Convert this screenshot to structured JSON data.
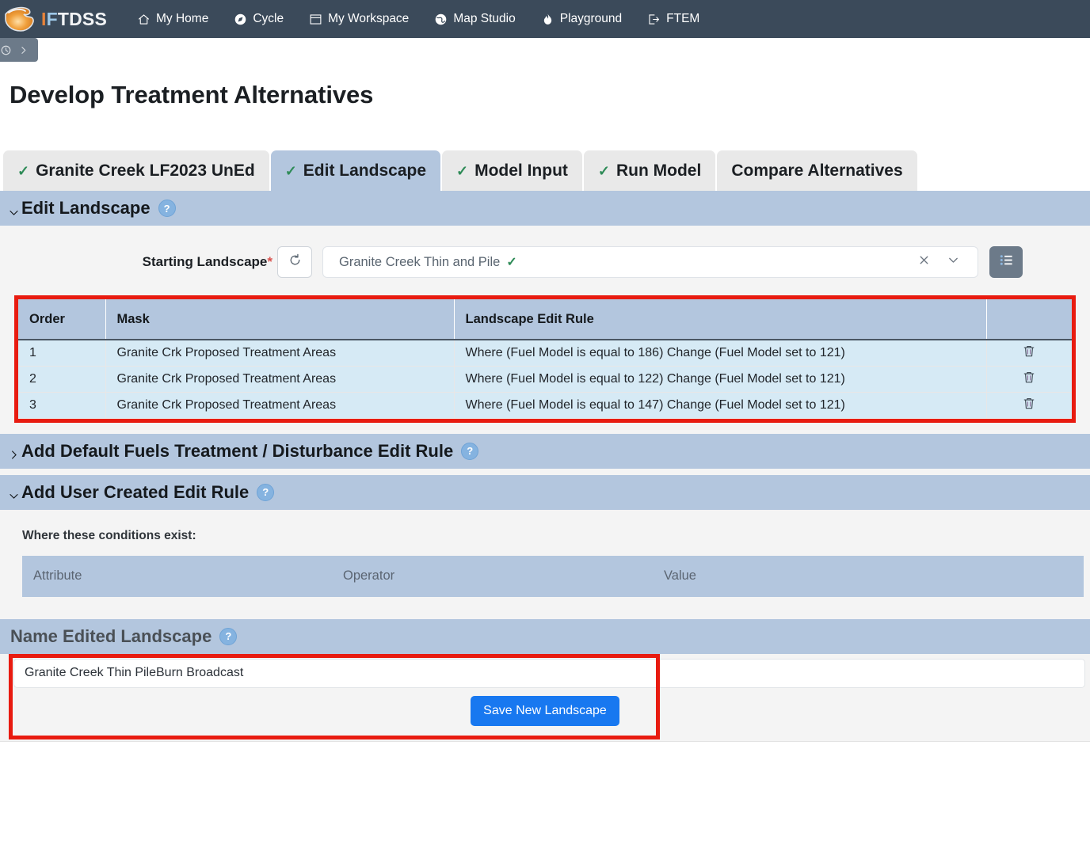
{
  "topnav": {
    "brand": {
      "part1": "I",
      "part2": "F",
      "part3": "TDSS",
      "logo_icon": "flame-swoosh-logo"
    },
    "items": [
      {
        "label": "My Home",
        "icon": "home-icon"
      },
      {
        "label": "Cycle",
        "icon": "cycle-compass-icon"
      },
      {
        "label": "My Workspace",
        "icon": "workspace-window-icon"
      },
      {
        "label": "Map Studio",
        "icon": "globe-icon"
      },
      {
        "label": "Playground",
        "icon": "flame-icon"
      },
      {
        "label": "FTEM",
        "icon": "logout-arrow-icon"
      }
    ]
  },
  "breadcrumb": {
    "back_icon": "history-circle-icon",
    "forward_icon": "chevron-right-icon"
  },
  "page": {
    "title": "Develop Treatment Alternatives"
  },
  "tabs": [
    {
      "label": "Granite Creek LF2023 UnEd",
      "checked": true,
      "active": false
    },
    {
      "label": "Edit Landscape",
      "checked": true,
      "active": true
    },
    {
      "label": "Model Input",
      "checked": true,
      "active": false
    },
    {
      "label": "Run Model",
      "checked": true,
      "active": false
    },
    {
      "label": "Compare Alternatives",
      "checked": false,
      "active": false
    }
  ],
  "edit_landscape": {
    "header": "Edit Landscape",
    "help_label": "?",
    "chevron": "chevron-down-icon",
    "starting_landscape": {
      "label": "Starting Landscape",
      "required_marker": "*",
      "value": "Granite Creek Thin and Pile",
      "value_check": "✓",
      "refresh_icon": "refresh-icon",
      "clear_icon": "clear-x-icon",
      "dropdown_icon": "chevron-down-icon",
      "list_icon": "list-view-icon"
    },
    "table": {
      "columns": [
        "Order",
        "Mask",
        "Landscape Edit Rule",
        ""
      ],
      "rows": [
        {
          "order": "1",
          "mask": "Granite Crk Proposed Treatment Areas",
          "rule": "Where (Fuel Model is equal to 186) Change (Fuel Model set to 121)",
          "delete_icon": "trash-icon"
        },
        {
          "order": "2",
          "mask": "Granite Crk Proposed Treatment Areas",
          "rule": "Where (Fuel Model is equal to 122) Change (Fuel Model set to 121)",
          "delete_icon": "trash-icon"
        },
        {
          "order": "3",
          "mask": "Granite Crk Proposed Treatment Areas",
          "rule": "Where (Fuel Model is equal to 147) Change (Fuel Model set to 121)",
          "delete_icon": "trash-icon"
        }
      ]
    }
  },
  "default_rule_section": {
    "header": "Add Default Fuels Treatment / Disturbance Edit Rule",
    "help_label": "?",
    "chevron": "chevron-right-icon",
    "expanded": false
  },
  "user_rule_section": {
    "header": "Add User Created Edit Rule",
    "help_label": "?",
    "chevron": "chevron-down-icon",
    "expanded": true,
    "conditions_label": "Where these conditions exist:",
    "condition_columns": [
      "Attribute",
      "Operator",
      "Value"
    ]
  },
  "name_section": {
    "header": "Name Edited Landscape",
    "help_label": "?",
    "input_value": "Granite Creek Thin PileBurn Broadcast",
    "input_placeholder": "",
    "save_label": "Save New Landscape"
  },
  "colors": {
    "nav_bg": "#3b4a5a",
    "section_header": "#b3c6de",
    "table_row": "#d6eaf5",
    "annotation": "#e81b10",
    "save_button": "#1878f0",
    "check_green": "#2e8b57",
    "panel_bg": "#f4f4f4"
  }
}
